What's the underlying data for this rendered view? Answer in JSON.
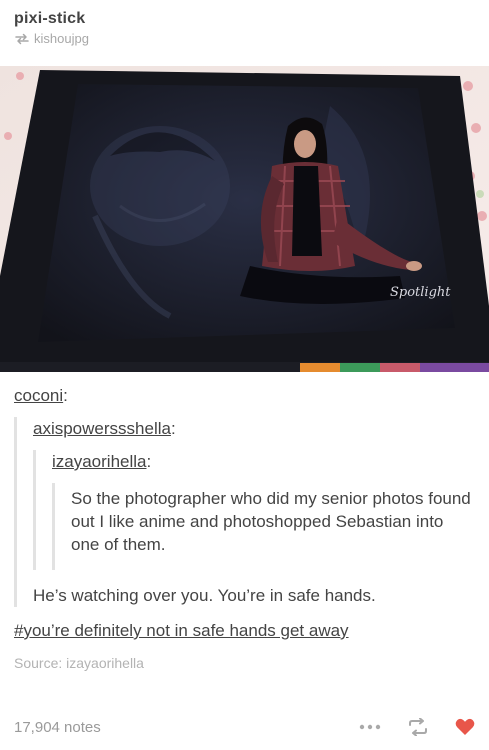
{
  "post": {
    "blog_name": "pixi-stick",
    "reblogged_from": "kishoujpg",
    "photo": {
      "stamp_text": "Spotlight",
      "colors": {
        "binder": "#1a1c24",
        "sheet": "#23273a",
        "bedspread": "#f2e6e6",
        "polka": "#e8a4a4"
      }
    },
    "thread": {
      "user1": "coconi",
      "user2": "axispowerssshella",
      "user3": "izayaorihella",
      "original_text": "So the photographer who did my senior photos found out I like anime and photoshopped Sebastian into one of them.",
      "reply_text": "He’s watching over you. You’re in safe hands.",
      "tag": "#you’re definitely not in safe hands get away"
    },
    "source": "Source: izayaorihella",
    "notes": "17,904 notes"
  },
  "icons": {
    "reblog": "reblog-icon",
    "more": "more-icon",
    "like": "heart-icon",
    "like_color": "#e8564a"
  }
}
